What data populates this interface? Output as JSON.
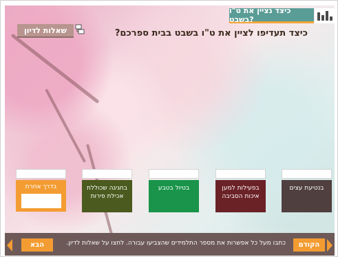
{
  "header": {
    "tab_title": "כיצד נציין את ט\"ו בשבט?"
  },
  "question": {
    "text": "כיצד תעדיפו לציין את ט\"ו בשבט בבית ספרכם?"
  },
  "discussion": {
    "button_label": "שאלות לדיון"
  },
  "options": [
    {
      "label": "בנטיעת עצים",
      "color": "#4f3f3e"
    },
    {
      "label": "בפעילות למען איכות הסביבה",
      "color": "#6b2227"
    },
    {
      "label": "בטיול בטבע",
      "color": "#19944a"
    },
    {
      "label": "בחגיגה שכוללת אכילת פירות",
      "color": "#4b5a1e"
    },
    {
      "label": "בדרך אחרת",
      "color": "#f39c32"
    }
  ],
  "footer": {
    "instructions": "כתבו מעל כל אפשרות את מספר התלמידים שהצביעו עבורה. לחצו על שאלות לדיון.",
    "prev_label": "הקודם",
    "next_label": "הבא",
    "bar_color": "#6d5a58",
    "accent_color": "#f39c32"
  }
}
